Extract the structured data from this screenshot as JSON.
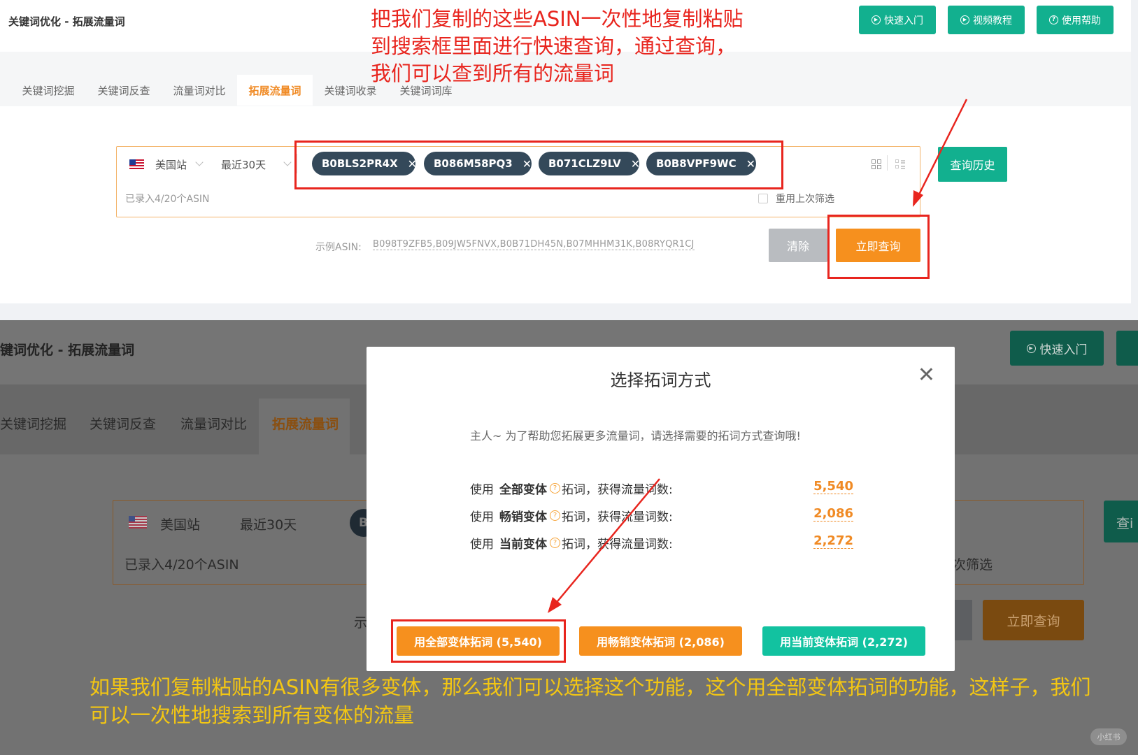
{
  "app": {
    "title": "关键词优化 - 拓展流量词",
    "title_clipped": "键词优化 - 拓展流量词"
  },
  "header_buttons": [
    {
      "label": "快速入门",
      "icon": "play-circle-icon"
    },
    {
      "label": "视频教程",
      "icon": "play-circle-icon"
    },
    {
      "label": "使用帮助",
      "icon": "help-circle-icon"
    }
  ],
  "tabs": [
    {
      "label": "关键词挖掘",
      "active": false
    },
    {
      "label": "关键词反查",
      "active": false
    },
    {
      "label": "流量词对比",
      "active": false
    },
    {
      "label": "拓展流量词",
      "active": true
    },
    {
      "label": "关键词收录",
      "active": false
    },
    {
      "label": "关键词词库",
      "active": false
    }
  ],
  "search": {
    "marketplace": "美国站",
    "period": "最近30天",
    "asin_chips": [
      "B0BLS2PR4X",
      "B086M58PQ3",
      "B071CLZ9LV",
      "B0B8VPF9WC"
    ],
    "count_hint": "已录入4/20个ASIN",
    "reuse_filter_label": "重用上次筛选",
    "history_button": "查询历史",
    "example_label": "示例ASIN:",
    "example_asins": "B098T9ZFB5,B09JW5FNVX,B0B71DH45N,B07MHHM31K,B08RYQR1CJ",
    "clear_button": "清除",
    "query_button": "立即查询"
  },
  "annotations": {
    "top_red": [
      "把我们复制的这些ASIN一次性地复制粘贴",
      "到搜索框里面进行快速查询，通过查询，",
      "我们可以查到所有的流量词"
    ],
    "bottom_yellow": [
      "如果我们复制粘贴的ASIN有很多变体，那么我们可以选择这个功能，这个用全部变体拓词的功能，这样子，我们",
      "可以一次性地搜索到所有变体的流量"
    ]
  },
  "bottom_background": {
    "chip_partial": "B",
    "example_partial": "示",
    "reuse_partial": "次筛选",
    "history_partial": "查i"
  },
  "modal": {
    "title": "选择拓词方式",
    "description": "主人~ 为了帮助您拓展更多流量词，请选择需要的拓词方式查询哦!",
    "options": [
      {
        "prefix": "使用",
        "name": "全部变体",
        "suffix": "拓词，获得流量词数:",
        "count": "5,540"
      },
      {
        "prefix": "使用",
        "name": "畅销变体",
        "suffix": "拓词，获得流量词数:",
        "count": "2,086"
      },
      {
        "prefix": "使用",
        "name": "当前变体",
        "suffix": "拓词，获得流量词数:",
        "count": "2,272"
      }
    ],
    "buttons": [
      {
        "label": "用全部变体拓词 (5,540)",
        "color": "#f6901e"
      },
      {
        "label": "用畅销变体拓词 (2,086)",
        "color": "#f6901e"
      },
      {
        "label": "用当前变体拓词 (2,272)",
        "color": "#12c2a0"
      }
    ]
  },
  "watermark": "小红书",
  "colors": {
    "teal": "#12b08f",
    "orange": "#f6901e",
    "annotation_red": "#e8251e",
    "annotation_yellow": "#f3c613"
  }
}
